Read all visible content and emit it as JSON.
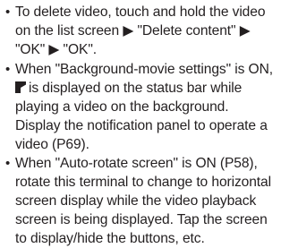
{
  "notes": [
    {
      "bullet": "•",
      "lines": [
        "To delete video, touch and hold the video",
        "on the list screen ▶ \"Delete content\" ▶",
        "\"OK\" ▶ \"OK\"."
      ]
    },
    {
      "bullet": "•",
      "lines": [
        "When \"Background-movie settings\" is ON,",
        "is displayed on the status bar while",
        "playing a video on the background.",
        "Display the notification panel to operate a",
        "video (P69)."
      ],
      "icon": "video-playing-status-icon"
    },
    {
      "bullet": "•",
      "lines": [
        "When \"Auto-rotate screen\" is ON (P58),",
        "rotate this terminal to change to horizontal",
        "screen display while the video playback",
        "screen is being displayed. Tap the screen",
        "to display/hide the buttons, etc."
      ]
    }
  ]
}
